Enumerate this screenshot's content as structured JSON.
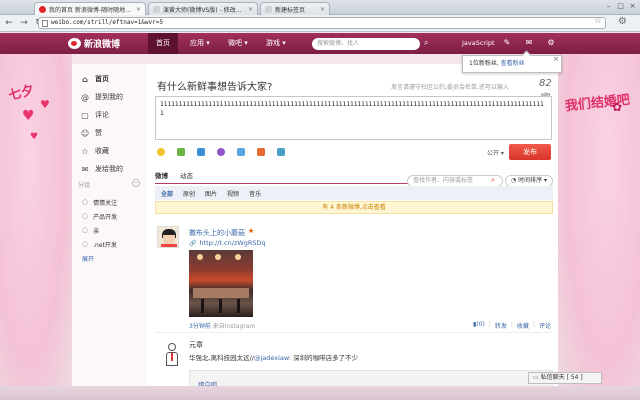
{
  "browser": {
    "tabs": [
      {
        "label": "我的首页 新浪微博-随时随地分享身边的新鲜事儿",
        "favicon_color": "#e2262a"
      },
      {
        "label": "演黄大师(微博VS版) - 修改后的界面和功能",
        "favicon_color": "#8a8f96"
      },
      {
        "label": "新建标签页",
        "favicon_color": "#8a8f96"
      }
    ],
    "url": "weibo.com/strill/eftnav=1&wvr=5",
    "window_buttons": [
      "–",
      "□",
      "×"
    ]
  },
  "topnav": {
    "logo": "新浪微博",
    "links": [
      "首页",
      "应用 ▾",
      "微吧 ▾",
      "游戏 ▾"
    ],
    "search_placeholder": "搜索微博、找人",
    "user": "JavaScript",
    "bg_color": "#8e2550"
  },
  "notification": {
    "text": "1位新粉丝,",
    "link": "查看粉丝",
    "close": "×"
  },
  "decor": {
    "left_title": "七夕",
    "right_title": "我们结婚吧"
  },
  "sidebar": {
    "items": [
      {
        "label": "首页",
        "icon": "home-icon",
        "glyph": "⌂"
      },
      {
        "label": "提到我的",
        "icon": "at-icon",
        "glyph": "@"
      },
      {
        "label": "评论",
        "icon": "comment-icon",
        "glyph": "▢"
      },
      {
        "label": "赞",
        "icon": "like-icon",
        "glyph": "☺"
      },
      {
        "label": "收藏",
        "icon": "favorite-icon",
        "glyph": "☆"
      },
      {
        "label": "发给我的",
        "icon": "message-icon",
        "glyph": "✉"
      }
    ],
    "group_label": "分组",
    "groups": [
      "情情关注",
      "产品开发",
      "亲",
      ".net开发"
    ],
    "expand": "展开"
  },
  "compose": {
    "title": "有什么新鲜事想告诉大家?",
    "hint": "发言请遵守社区公约,委员会名单,还可以输入",
    "count": "82字",
    "text": "11111111111111111111111111111111111111111111111111111111111111111111111111111111111111111111111111111111",
    "visibility": "公开 ▾",
    "post_button": "发布"
  },
  "feed": {
    "tabs": [
      "微博",
      "动态"
    ],
    "search_placeholder": "查找作者、内容或标签",
    "sort": "◔ 时间排序 ▾",
    "filters": [
      "全部",
      "原创",
      "图片",
      "视频",
      "音乐"
    ],
    "new_notice": "有 4 条新微博,点击查看",
    "posts": [
      {
        "author": "撒布头上的小蘑菇",
        "link": "http://t.cn/zWgRSDq",
        "time": "3分钟前",
        "source": "来自Instagram",
        "actions": [
          "▮(0)",
          "转发",
          "收藏",
          "评论"
        ]
      },
      {
        "author": "元章",
        "text_prefix": "华强北,离科技园太远//",
        "mention": "@jadexiaw",
        "text_suffix": ": 深圳的咖啡店多了不少",
        "repost_author": "缘白鸥"
      }
    ]
  },
  "chat": {
    "label": "私信聊天 [ 54 ]"
  }
}
